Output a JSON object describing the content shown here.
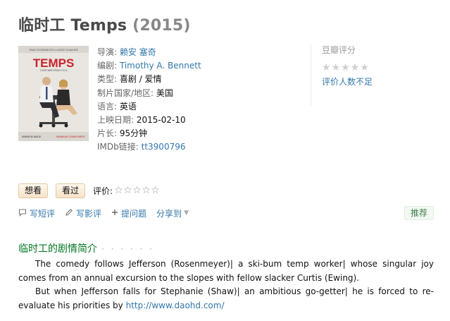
{
  "title": {
    "name": "临时工 Temps",
    "year": "(2015)"
  },
  "poster": {
    "credits_top": "GRANT ROSENMEYER & LINDSEY SHAW ARE",
    "movie_title": "TEMPS",
    "tagline": "TOGETHER FROM 9 TO 5",
    "bottom_left": "MINIMUM WAGE",
    "bottom_right": "MINIMUM COMMITMENT"
  },
  "info": {
    "director_label": "导演:",
    "director": "赖安 塞奇",
    "writer_label": "编剧:",
    "writer": "Timothy A. Bennett",
    "genre_label": "类型:",
    "genre": "喜剧 / 爱情",
    "country_label": "制片国家/地区:",
    "country": "美国",
    "language_label": "语言:",
    "language": "英语",
    "release_label": "上映日期:",
    "release": "2015-02-10",
    "runtime_label": "片长:",
    "runtime": "95分钟",
    "imdb_label": "IMDb链接:",
    "imdb": "tt3900796"
  },
  "rating": {
    "label": "豆瓣评分",
    "stars": "★★★★★",
    "few": "评价人数不足",
    "score": 0
  },
  "actions": {
    "want": "想看",
    "seen": "看过",
    "rate_label": "评价:",
    "rate_stars": "☆☆☆☆☆"
  },
  "tools": {
    "short_review": "写短评",
    "review": "写影评",
    "question": "提问题",
    "share": "分享到",
    "recommend": "推荐"
  },
  "intro": {
    "heading": "临时工的剧情简介",
    "dots": "· · · · · ·",
    "para1": "The comedy follows Jefferson (Rosenmeyer)| a ski-bum temp worker| whose singular joy comes from an annual excursion to the slopes with fellow slacker Curtis (Ewing).",
    "para2_text": "But when Jefferson falls for Stephanie (Shaw)| an ambitious go-getter| he is forced to re-evaluate his priorities by ",
    "para2_link": "http://www.daohd.com/"
  },
  "colors": {
    "link": "#3377aa",
    "intro_heading": "#007722",
    "title": "#494949",
    "year": "#888888",
    "button_border": "#e3c9a3",
    "recommend_text": "#3d7d4b"
  }
}
